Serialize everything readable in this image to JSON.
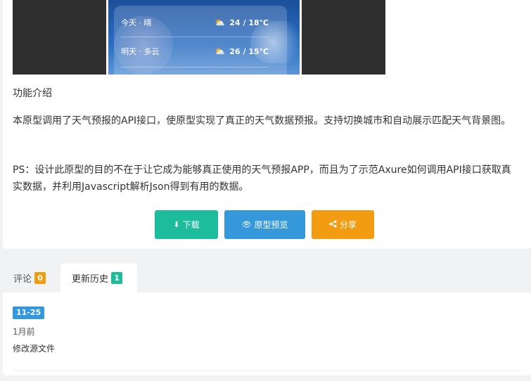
{
  "preview": {
    "forecast": [
      {
        "day": "今天 · 晴",
        "icon": "partly-cloudy-icon",
        "temp": "24 / 18℃"
      },
      {
        "day": "明天 · 多云",
        "icon": "partly-cloudy-icon",
        "temp": "26 / 15℃"
      }
    ]
  },
  "section": {
    "title": "功能介绍",
    "p1": "本原型调用了天气预报的API接口，使原型实现了真正的天气数据预报。支持切换城市和自动展示匹配天气背景图。",
    "p2": "PS：设计此原型的目的不在于让它成为能够真正使用的天气预报APP，而且为了示范Axure如何调用API接口获取真实数据，并利用Javascript解析Json得到有用的数据。"
  },
  "actions": {
    "download": "下载",
    "preview": "原型预览",
    "share": "分享"
  },
  "tabs": {
    "comments_label": "评论",
    "comments_count": "0",
    "history_label": "更新历史",
    "history_count": "1"
  },
  "history": {
    "date": "11-25",
    "ago": "1月前",
    "note": "修改源文件"
  },
  "colors": {
    "download": "#1cbc9c",
    "preview": "#3498db",
    "share": "#f39c12"
  }
}
